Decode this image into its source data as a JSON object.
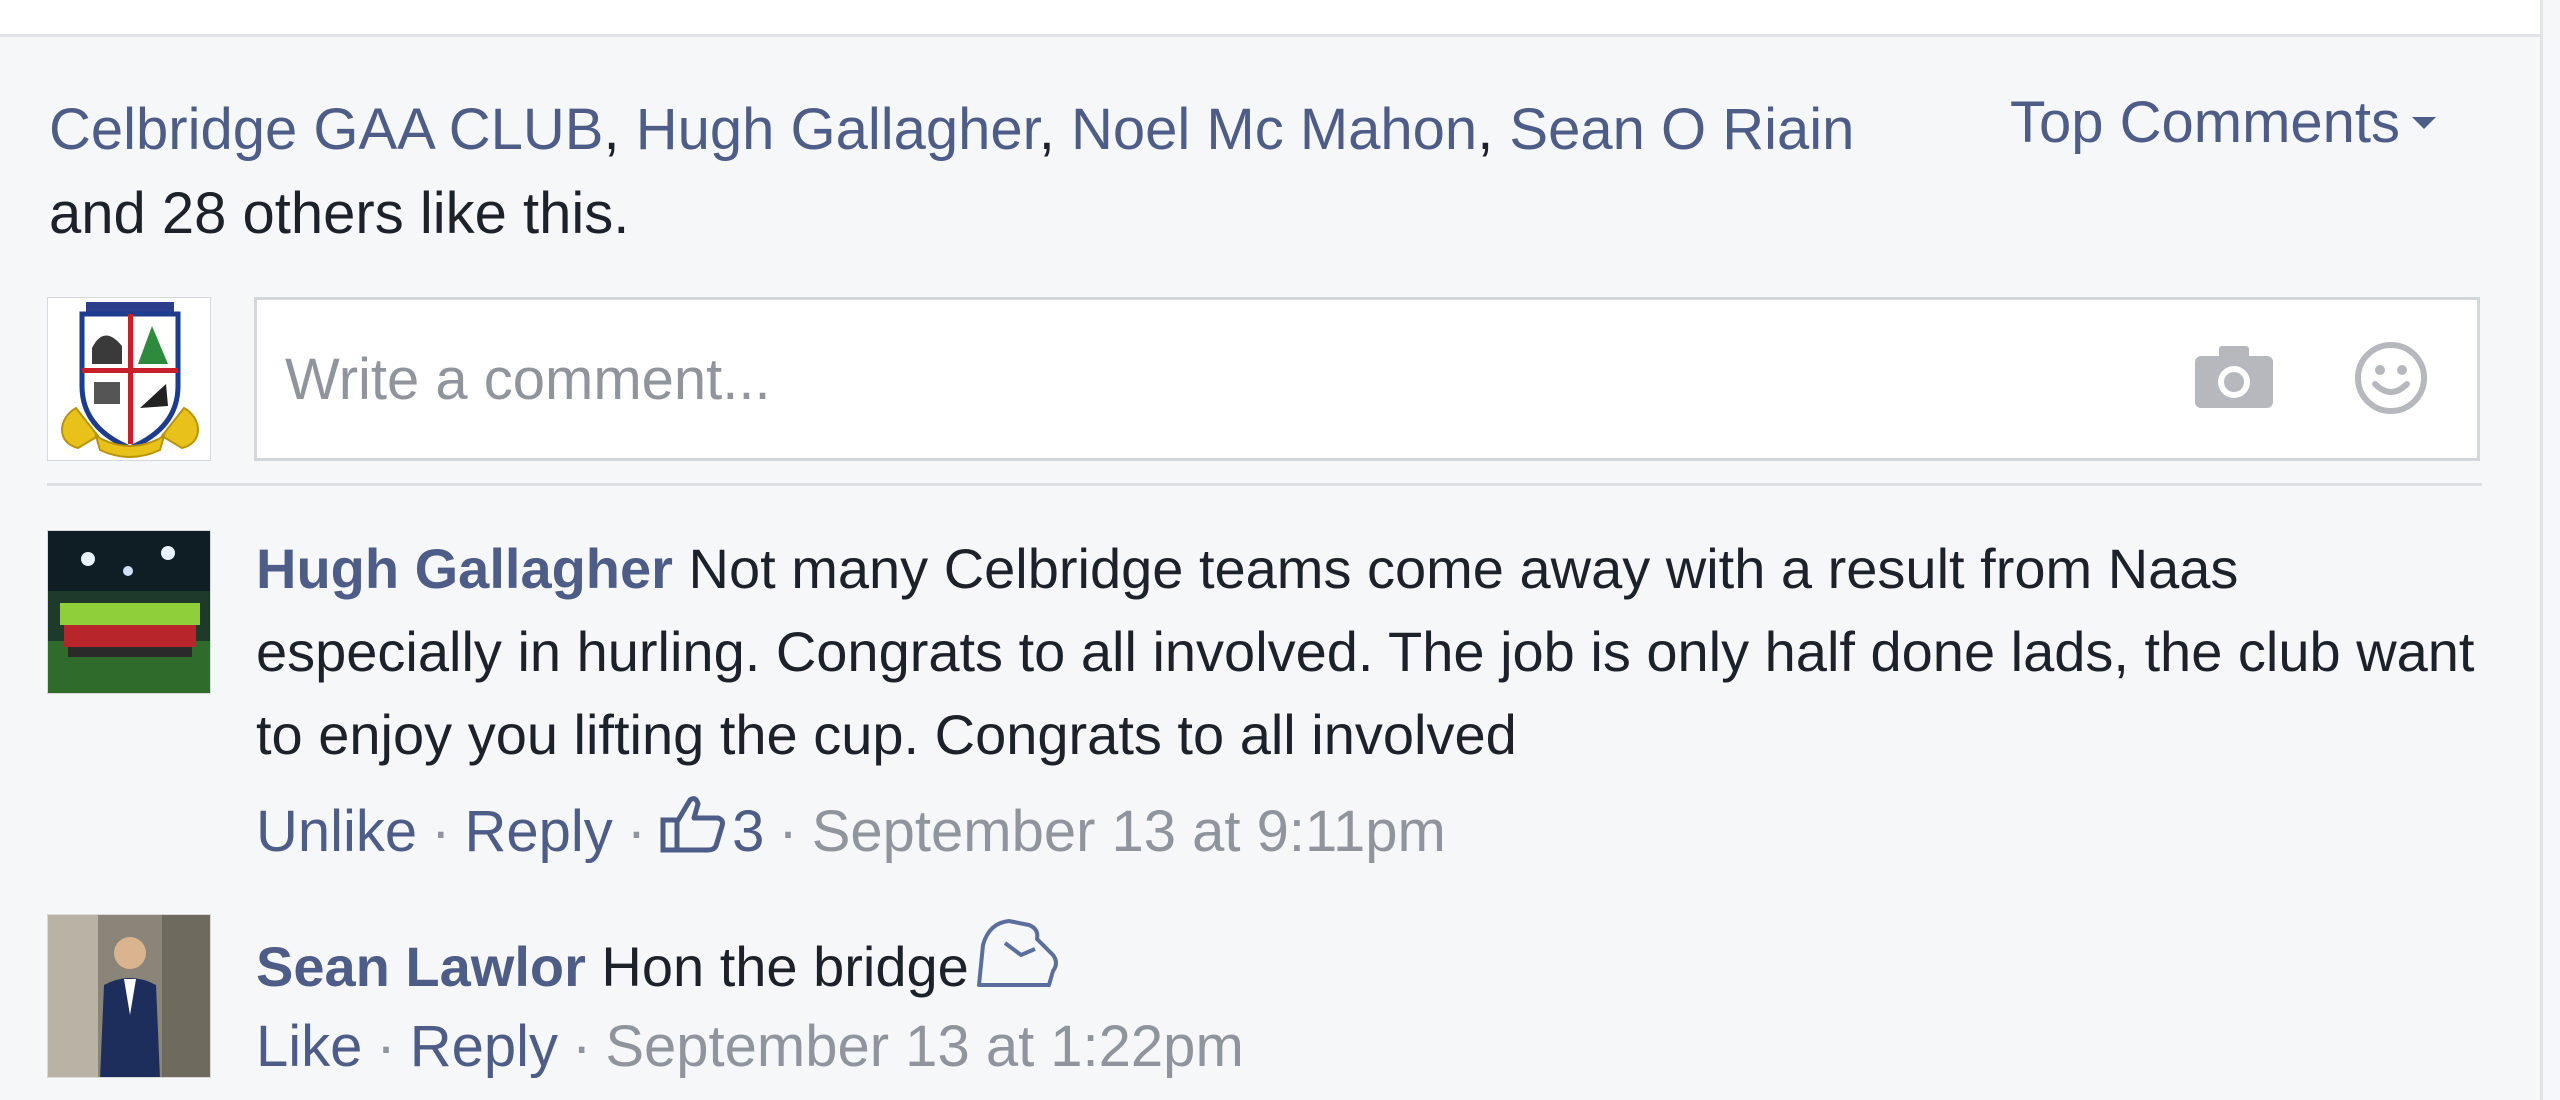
{
  "likes_summary": {
    "names": [
      "Celbridge GAA CLUB",
      "Hugh Gallagher",
      "Noel Mc Mahon",
      "Sean O Riain"
    ],
    "suffix": " and 28 others like this."
  },
  "sort_menu": {
    "label": "Top Comments"
  },
  "composer": {
    "placeholder": "Write a comment..."
  },
  "comments": [
    {
      "author": "Hugh Gallagher",
      "text": " Not many Celbridge teams come away with a result from Naas especially in hurling. Congrats to all involved. The job is only half done lads, the club want to enjoy you lifting the cup. Congrats to all involved",
      "like_action": "Unlike",
      "reply_action": "Reply",
      "like_count": "3",
      "timestamp": "September 13 at 9:11pm"
    },
    {
      "author": "Sean Lawlor",
      "text": " Hon the bridge",
      "like_action": "Like",
      "reply_action": "Reply",
      "timestamp": "September 13 at 1:22pm"
    }
  ],
  "colors": {
    "link": "#4e5d87",
    "meta": "#90949c",
    "background": "#f6f7f9"
  }
}
